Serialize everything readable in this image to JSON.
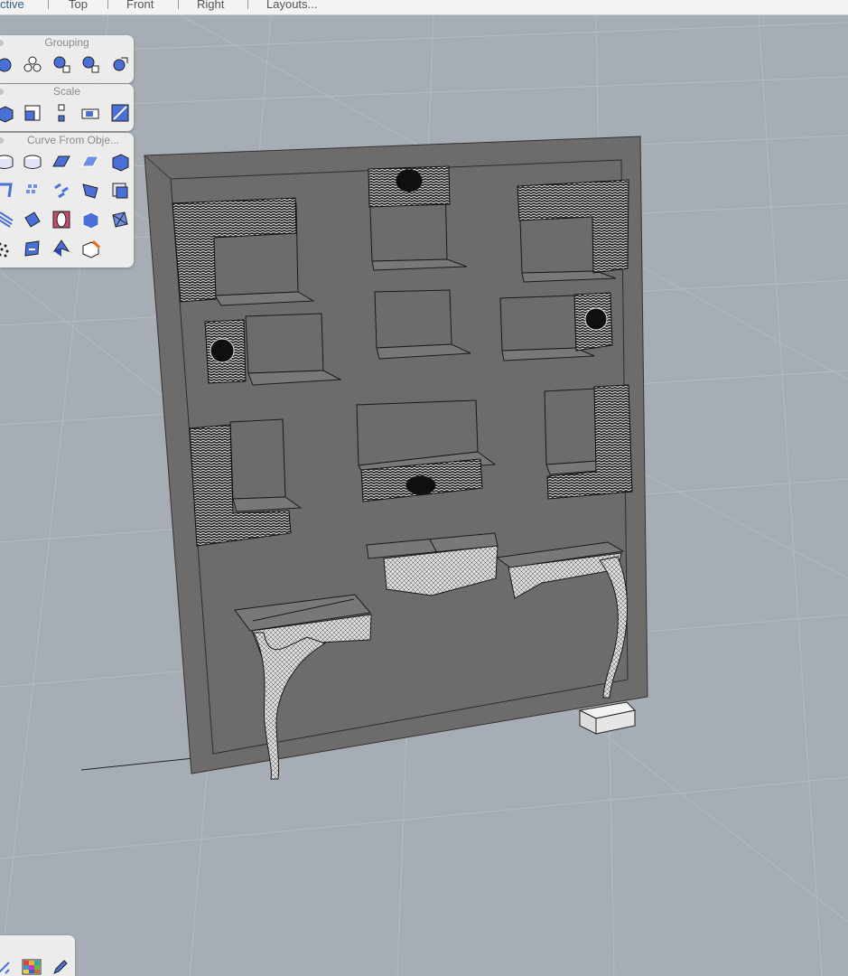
{
  "tabs": [
    {
      "label": "ctive",
      "active": true
    },
    {
      "label": "Top",
      "active": false
    },
    {
      "label": "Front",
      "active": false
    },
    {
      "label": "Right",
      "active": false
    },
    {
      "label": "Layouts...",
      "active": false
    }
  ],
  "panels": {
    "grouping": {
      "title": "Grouping",
      "icons": [
        "ungroup-icon",
        "group-icon",
        "add-to-group-icon",
        "remove-from-group-icon",
        "set-group-name-icon"
      ]
    },
    "scale": {
      "title": "Scale",
      "icons": [
        "scale-3d-icon",
        "scale-2d-icon",
        "scale-1d-icon",
        "scale-nonuniform-icon",
        "shear-icon"
      ]
    },
    "curve_from_objects": {
      "title": "Curve From Obje...",
      "icons": [
        "project-curve-icon",
        "pull-curve-icon",
        "duplicate-edge-icon",
        "duplicate-border-icon",
        "duplicate-face-border-icon",
        "extract-isocurve-icon",
        "extract-wireframe-icon",
        "intersection-icon",
        "contour-icon",
        "section-icon",
        "silhouette-icon",
        "make-2d-icon",
        "extract-points-icon",
        "unroll-icon",
        "mesh-outline-icon",
        "extract-curvature-icon",
        "blend-icon",
        "curve-from-points-icon",
        "hull-icon"
      ]
    }
  },
  "bottom_panel": {
    "icons": [
      "transform-icon",
      "color-grid-icon",
      "edit-icon"
    ]
  },
  "colors": {
    "viewport_bg": "#a6adb4",
    "grid_line": "#b4bac1",
    "wall": "#6e6c6a",
    "wireframe": "#1a1a1a",
    "shelf_top": "#7a7876",
    "panel_bg": "#ececec",
    "icon_blue": "#4a6fd6"
  }
}
